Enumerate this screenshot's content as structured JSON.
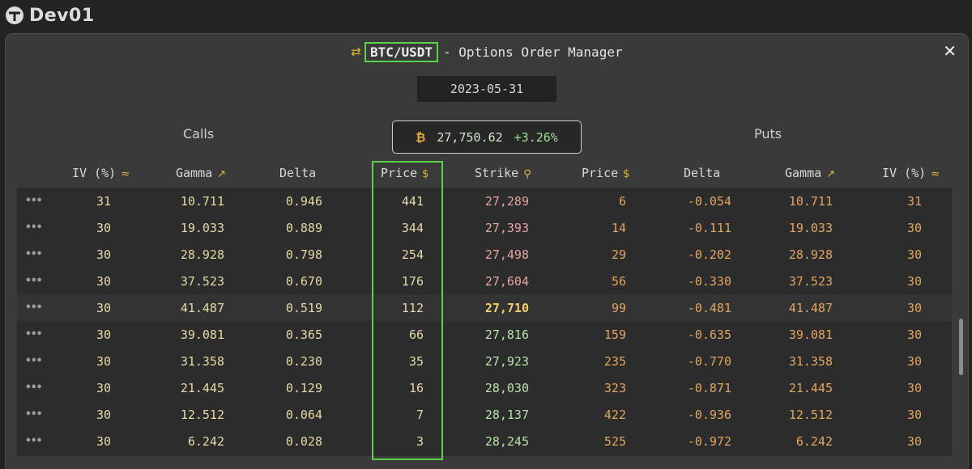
{
  "app": {
    "brand": "Dev01"
  },
  "window": {
    "pair": "BTC/USDT",
    "title_suffix": "- Options Order Manager",
    "close_label": "✕",
    "date": "2023-05-31",
    "calls_label": "Calls",
    "puts_label": "Puts",
    "spot_price": "27,750.62",
    "spot_change": "+3.26%"
  },
  "columns": {
    "call_iv": "IV (%)",
    "call_gamma": "Gamma",
    "call_delta": "Delta",
    "call_price": "Price",
    "strike": "Strike",
    "put_price": "Price",
    "put_delta": "Delta",
    "put_gamma": "Gamma",
    "put_iv": "IV (%)"
  },
  "colors": {
    "highlight": "#59d24a",
    "accent": "#e6b93a",
    "strike_itm": "#e8a4a0",
    "strike_atm": "#f2d06b",
    "strike_otm": "#b6e3a8"
  },
  "rows": [
    {
      "call_iv": "31",
      "call_gamma": "10.711",
      "call_delta": "0.946",
      "call_price": "441",
      "strike": "27,289",
      "put_price": "6",
      "put_delta": "-0.054",
      "put_gamma": "10.711",
      "put_iv": "31"
    },
    {
      "call_iv": "30",
      "call_gamma": "19.033",
      "call_delta": "0.889",
      "call_price": "344",
      "strike": "27,393",
      "put_price": "14",
      "put_delta": "-0.111",
      "put_gamma": "19.033",
      "put_iv": "30"
    },
    {
      "call_iv": "30",
      "call_gamma": "28.928",
      "call_delta": "0.798",
      "call_price": "254",
      "strike": "27,498",
      "put_price": "29",
      "put_delta": "-0.202",
      "put_gamma": "28.928",
      "put_iv": "30"
    },
    {
      "call_iv": "30",
      "call_gamma": "37.523",
      "call_delta": "0.670",
      "call_price": "176",
      "strike": "27,604",
      "put_price": "56",
      "put_delta": "-0.330",
      "put_gamma": "37.523",
      "put_iv": "30"
    },
    {
      "call_iv": "30",
      "call_gamma": "41.487",
      "call_delta": "0.519",
      "call_price": "112",
      "strike": "27,710",
      "put_price": "99",
      "put_delta": "-0.481",
      "put_gamma": "41.487",
      "put_iv": "30"
    },
    {
      "call_iv": "30",
      "call_gamma": "39.081",
      "call_delta": "0.365",
      "call_price": "66",
      "strike": "27,816",
      "put_price": "159",
      "put_delta": "-0.635",
      "put_gamma": "39.081",
      "put_iv": "30"
    },
    {
      "call_iv": "30",
      "call_gamma": "31.358",
      "call_delta": "0.230",
      "call_price": "35",
      "strike": "27,923",
      "put_price": "235",
      "put_delta": "-0.770",
      "put_gamma": "31.358",
      "put_iv": "30"
    },
    {
      "call_iv": "30",
      "call_gamma": "21.445",
      "call_delta": "0.129",
      "call_price": "16",
      "strike": "28,030",
      "put_price": "323",
      "put_delta": "-0.871",
      "put_gamma": "21.445",
      "put_iv": "30"
    },
    {
      "call_iv": "30",
      "call_gamma": "12.512",
      "call_delta": "0.064",
      "call_price": "7",
      "strike": "28,137",
      "put_price": "422",
      "put_delta": "-0.936",
      "put_gamma": "12.512",
      "put_iv": "30"
    },
    {
      "call_iv": "30",
      "call_gamma": "6.242",
      "call_delta": "0.028",
      "call_price": "3",
      "strike": "28,245",
      "put_price": "525",
      "put_delta": "-0.972",
      "put_gamma": "6.242",
      "put_iv": "30"
    }
  ],
  "atm_index": 4
}
